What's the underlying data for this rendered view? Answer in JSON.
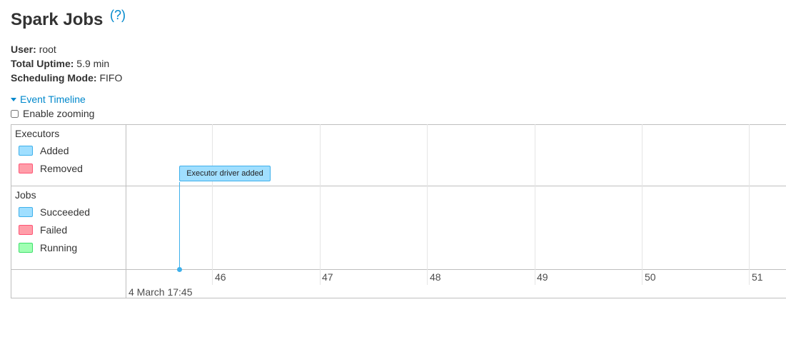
{
  "header": {
    "title": "Spark Jobs",
    "help": "(?)"
  },
  "info": {
    "user_label": "User:",
    "user_value": "root",
    "uptime_label": "Total Uptime:",
    "uptime_value": "5.9 min",
    "mode_label": "Scheduling Mode:",
    "mode_value": "FIFO"
  },
  "timeline": {
    "toggle_label": "Event Timeline",
    "zoom_label": "Enable zooming",
    "executors": {
      "label": "Executors",
      "legend": [
        {
          "label": "Added",
          "color": "#a0dfff"
        },
        {
          "label": "Removed",
          "color": "#ff9ea9"
        }
      ]
    },
    "jobs": {
      "label": "Jobs",
      "legend": [
        {
          "label": "Succeeded",
          "color": "#a0dfff"
        },
        {
          "label": "Failed",
          "color": "#ff9ea9"
        },
        {
          "label": "Running",
          "color": "#a0ffb3"
        }
      ]
    },
    "axis": {
      "minor_ticks": [
        "46",
        "47",
        "48",
        "49",
        "50",
        "51"
      ],
      "major_label": "4 March 17:45"
    },
    "event": {
      "label": "Executor driver added"
    }
  },
  "colors": {
    "link": "#0088cc",
    "event": "#3eb0eb"
  }
}
